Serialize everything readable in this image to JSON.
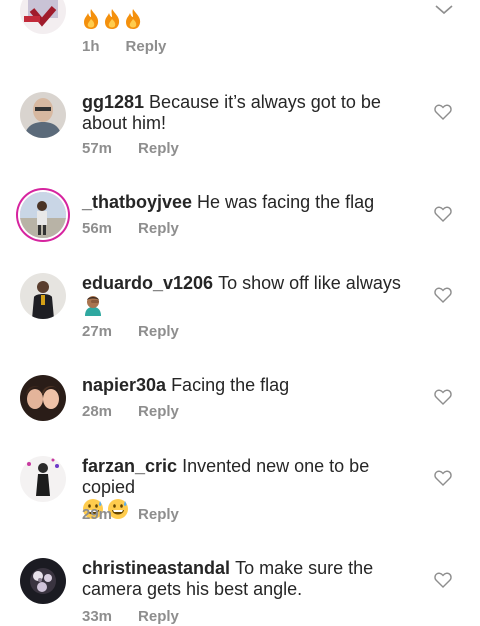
{
  "comments": [
    {
      "username": "",
      "text": "",
      "emojis": [
        "fire",
        "fire",
        "fire"
      ],
      "time": "1h",
      "reply_label": "Reply",
      "avatar_icon": "partial-avatar-icon"
    },
    {
      "username": "gg1281",
      "text": "Because it’s always got to be about him!",
      "time": "57m",
      "reply_label": "Reply",
      "avatar_icon": "bald-man-avatar"
    },
    {
      "username": "_thatboyjvee",
      "text": "He was facing the flag",
      "time": "56m",
      "reply_label": "Reply",
      "avatar_icon": "story-ring-avatar"
    },
    {
      "username": "eduardo_v1206",
      "text": "To show off like always",
      "emojis": [
        "man-facepalming"
      ],
      "time": "27m",
      "reply_label": "Reply",
      "avatar_icon": "suited-man-avatar"
    },
    {
      "username": "napier30a",
      "text": "Facing the flag",
      "time": "28m",
      "reply_label": "Reply",
      "avatar_icon": "two-women-avatar"
    },
    {
      "username": "farzan_cric",
      "text": "Invented new one to be copied",
      "emojis": [
        "grinning-sweat",
        "grinning-sweat"
      ],
      "time": "29m",
      "reply_label": "Reply",
      "avatar_icon": "dark-figure-avatar"
    },
    {
      "username": "christineastandal",
      "text": "To make sure the camera gets his best angle.",
      "time": "33m",
      "reply_label": "Reply",
      "avatar_icon": "flowers-avatar"
    }
  ],
  "icons": {
    "like": "heart-outline-icon",
    "collapse": "chevron-down-icon"
  },
  "colors": {
    "text": "#262626",
    "meta": "#8e8e8e",
    "story_ring": "#d6249f",
    "heart_stroke": "#8e8e8e"
  }
}
